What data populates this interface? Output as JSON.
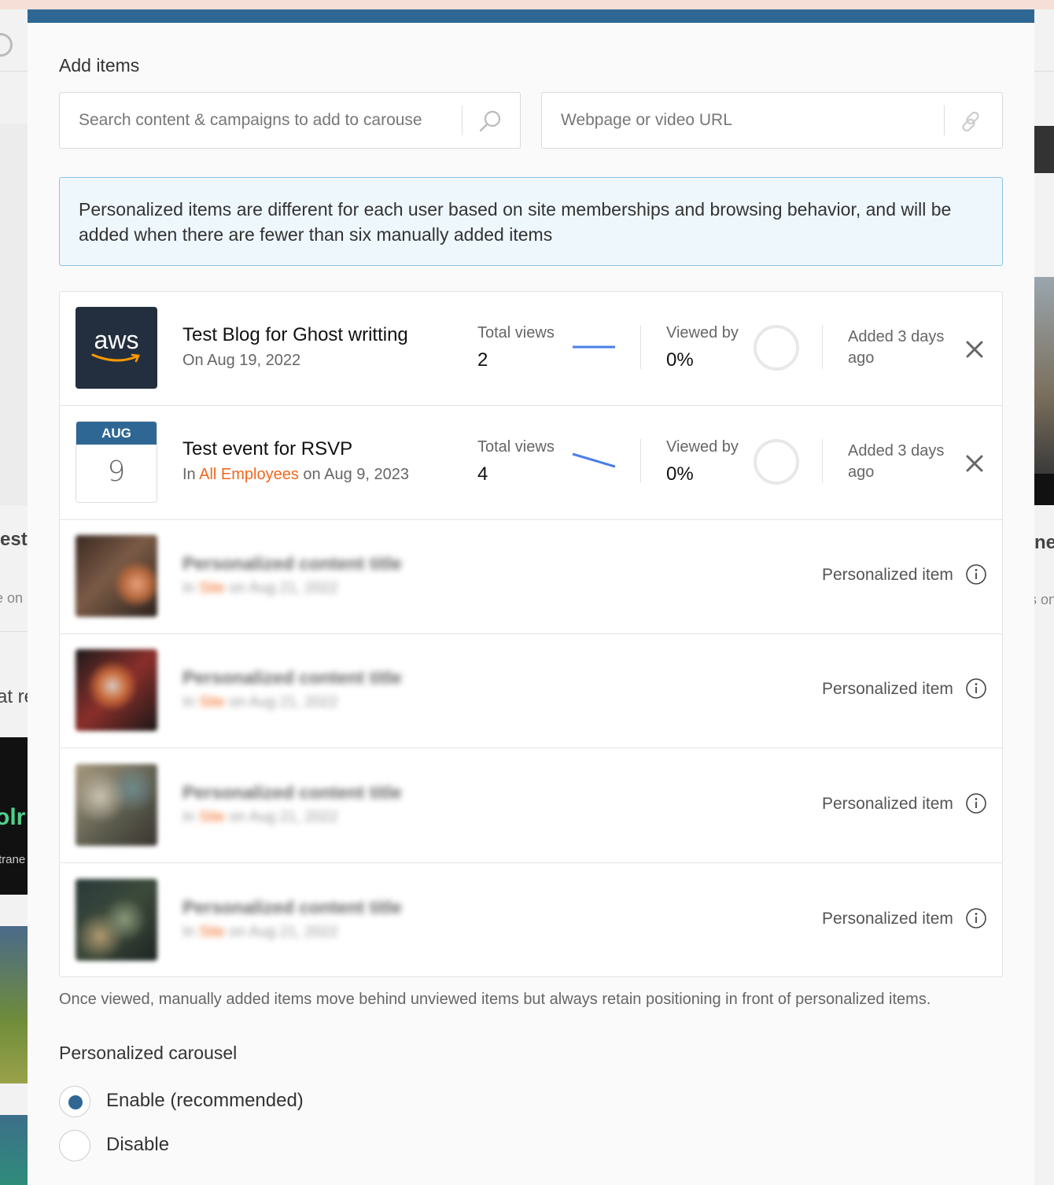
{
  "add_items": {
    "title": "Add items",
    "search_placeholder": "Search content & campaigns to add to carouse",
    "url_placeholder": "Webpage or video URL"
  },
  "info_message": "Personalized items are different for each user based on site memberships and browsing behavior, and will be added when there are fewer than six manually added items",
  "items": [
    {
      "title": "Test Blog for Ghost writting",
      "subtitle": "On Aug 19, 2022",
      "views_label": "Total views",
      "views": "2",
      "viewed_label": "Viewed by",
      "viewed": "0%",
      "added": "Added 3 days ago",
      "thumb_text": "aws"
    },
    {
      "title": "Test event for RSVP",
      "subtitle_prefix": "In ",
      "subtitle_link": "All Employees",
      "subtitle_suffix": " on Aug 9, 2023",
      "views_label": "Total views",
      "views": "4",
      "viewed_label": "Viewed by",
      "viewed": "0%",
      "added": "Added 3 days ago",
      "cal_month": "AUG",
      "cal_day": "9"
    }
  ],
  "personalized": [
    {
      "title": "Personalized content title",
      "sub_prefix": "In ",
      "sub_link": "Site",
      "sub_suffix": " on Aug 21, 2022",
      "label": "Personalized item"
    },
    {
      "title": "Personalized content title",
      "sub_prefix": "In ",
      "sub_link": "Site",
      "sub_suffix": " on Aug 21, 2022",
      "label": "Personalized item"
    },
    {
      "title": "Personalized content title",
      "sub_prefix": "In ",
      "sub_link": "Site",
      "sub_suffix": " on Aug 21, 2022",
      "label": "Personalized item"
    },
    {
      "title": "Personalized content title",
      "sub_prefix": "In ",
      "sub_link": "Site",
      "sub_suffix": " on Aug 21, 2022",
      "label": "Personalized item"
    }
  ],
  "footnote": "Once viewed, manually added items move behind unviewed items but always retain positioning in front of personalized items.",
  "personalized_carousel": {
    "title": "Personalized carousel",
    "options": [
      "Enable (recommended)",
      "Disable"
    ],
    "selected": "Enable (recommended)"
  },
  "background": {
    "left_fragments": [
      "est",
      "e on",
      "at re",
      "olr",
      "trane"
    ],
    "right_fragments": [
      "ne",
      "s on"
    ]
  },
  "colors": {
    "accent": "#2e6794",
    "link": "#f0671e",
    "info_bg": "#eef7fc",
    "info_border": "#8ec3e6",
    "sparkline": "#4a7fe8"
  }
}
